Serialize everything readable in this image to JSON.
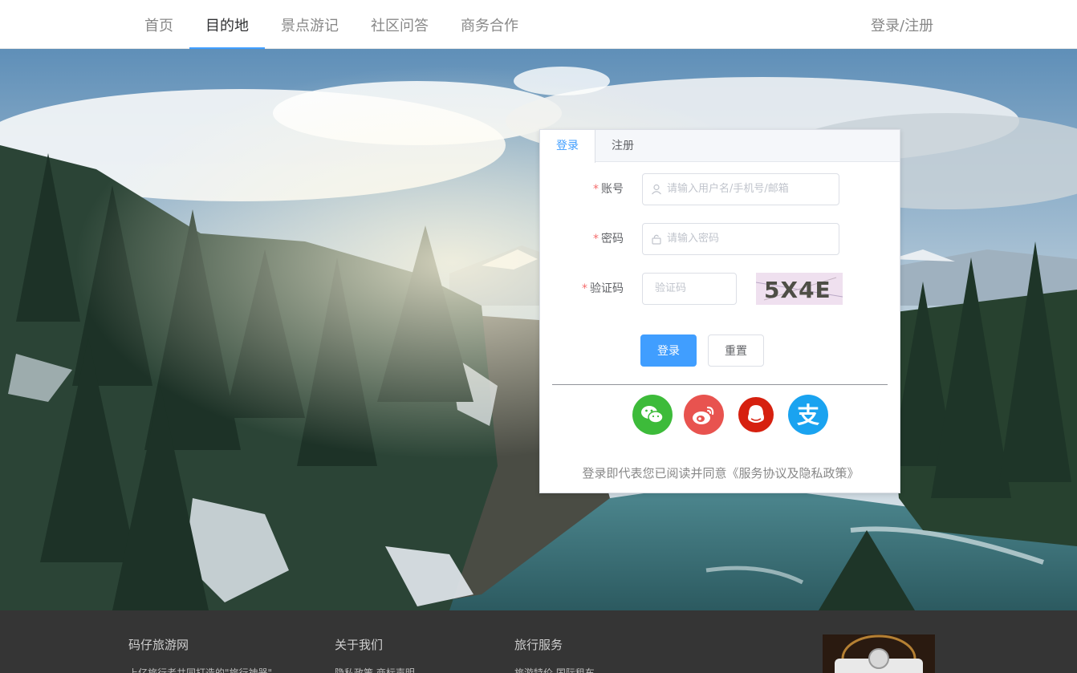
{
  "header": {
    "nav": [
      "首页",
      "目的地",
      "景点游记",
      "社区问答",
      "商务合作"
    ],
    "active_index": 1,
    "login_label": "登录/注册"
  },
  "login_card": {
    "tabs": [
      "登录",
      "注册"
    ],
    "active_tab": 0,
    "fields": {
      "account": {
        "label": "账号",
        "placeholder": "请输入用户名/手机号/邮箱",
        "icon": "user-icon"
      },
      "password": {
        "label": "密码",
        "placeholder": "请输入密码",
        "icon": "lock-icon"
      },
      "captcha": {
        "label": "验证码",
        "placeholder": "验证码"
      }
    },
    "captcha_text": "5X4E",
    "buttons": {
      "login": "登录",
      "reset": "重置"
    },
    "social": [
      {
        "name": "wechat",
        "color": "#3dbb3a"
      },
      {
        "name": "weibo",
        "color": "#e8534f"
      },
      {
        "name": "qq",
        "color": "#d6200f"
      },
      {
        "name": "alipay",
        "color": "#1aa3f0"
      }
    ],
    "alipay_glyph": "支",
    "agreement": "登录即代表您已阅读并同意《服务协议及隐私政策》"
  },
  "footer": {
    "columns": [
      {
        "title": "码仔旅游网",
        "text": "上亿旅行者共同打造的\"旅行神器\""
      },
      {
        "title": "关于我们",
        "text": "隐私政策 商标声明"
      },
      {
        "title": "旅行服务",
        "text": "旅游特价 国际租车"
      }
    ]
  },
  "colors": {
    "accent": "#409eff",
    "footer_bg": "#353535",
    "required": "#f56c6c"
  }
}
